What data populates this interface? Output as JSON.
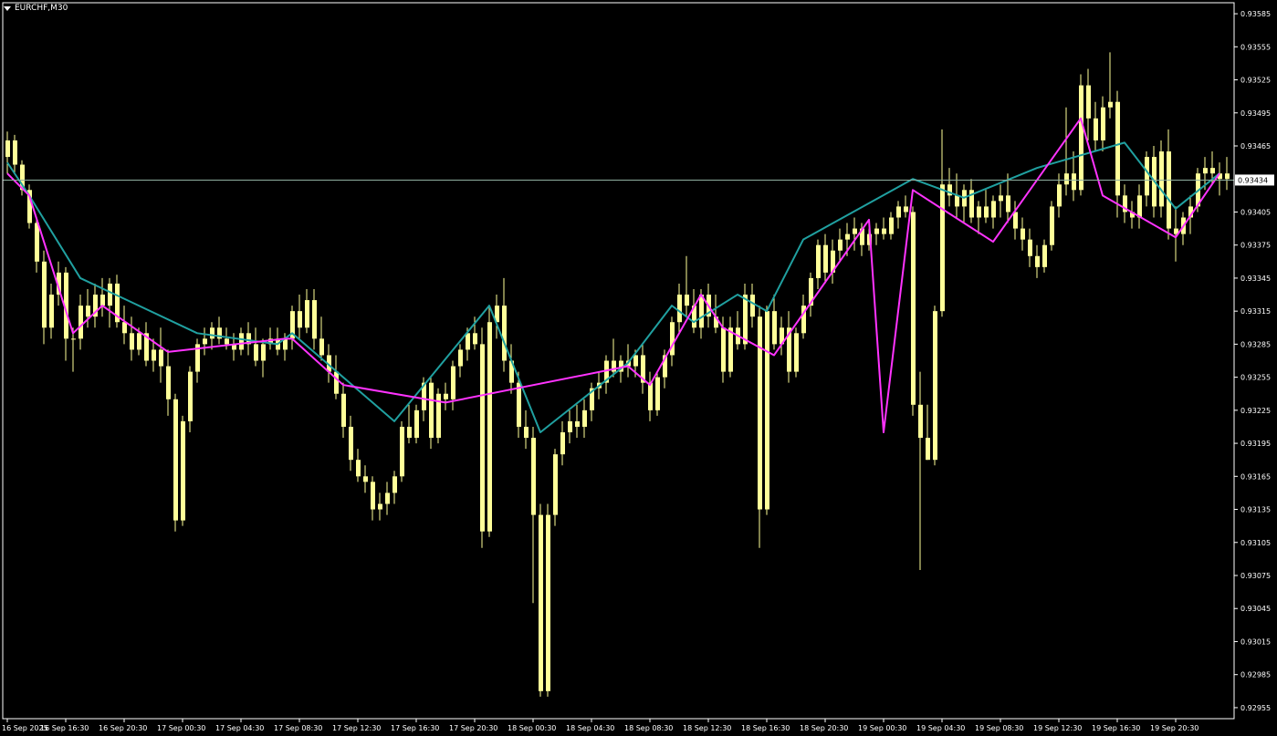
{
  "title": "EURCHF,M30",
  "colors": {
    "background": "#000000",
    "axis": "#ffffff",
    "candle": "#ffff99",
    "zigzag_main": "#ff33ff",
    "zigzag_secondary": "#20a0a0",
    "current_price_line": "#8fb0a0"
  },
  "chart_data": {
    "type": "candlestick",
    "symbol": "EURCHF",
    "timeframe": "M30",
    "y_ticks": [
      "0.93585",
      "0.93555",
      "0.93525",
      "0.93495",
      "0.93465",
      "0.93434",
      "0.93405",
      "0.93375",
      "0.93345",
      "0.93315",
      "0.93285",
      "0.93255",
      "0.93225",
      "0.93195",
      "0.93165",
      "0.93135",
      "0.93105",
      "0.93075",
      "0.93045",
      "0.93015",
      "0.92985",
      "0.92955"
    ],
    "y_range": [
      0.92945,
      0.93595
    ],
    "current_price": 0.93434,
    "x_labels": [
      "16 Sep 2025",
      "16 Sep 16:30",
      "16 Sep 20:30",
      "17 Sep 00:30",
      "17 Sep 04:30",
      "17 Sep 08:30",
      "17 Sep 12:30",
      "17 Sep 16:30",
      "17 Sep 20:30",
      "18 Sep 00:30",
      "18 Sep 04:30",
      "18 Sep 08:30",
      "18 Sep 12:30",
      "18 Sep 16:30",
      "18 Sep 20:30",
      "19 Sep 00:30",
      "19 Sep 04:30",
      "19 Sep 08:30",
      "19 Sep 12:30",
      "19 Sep 16:30",
      "19 Sep 20:30"
    ],
    "bars_per_label": 8,
    "candles": [
      [
        0.93455,
        0.93478,
        0.9344,
        0.9347
      ],
      [
        0.9347,
        0.93475,
        0.9344,
        0.93448
      ],
      [
        0.93448,
        0.93452,
        0.9342,
        0.93425
      ],
      [
        0.93425,
        0.9343,
        0.9339,
        0.93395
      ],
      [
        0.93395,
        0.934,
        0.9335,
        0.9336
      ],
      [
        0.9336,
        0.9337,
        0.93285,
        0.933
      ],
      [
        0.933,
        0.9334,
        0.9329,
        0.9333
      ],
      [
        0.9333,
        0.9336,
        0.9332,
        0.9335
      ],
      [
        0.9335,
        0.93355,
        0.9327,
        0.9329
      ],
      [
        0.9329,
        0.933,
        0.9326,
        0.9329
      ],
      [
        0.9329,
        0.9333,
        0.9328,
        0.9332
      ],
      [
        0.9332,
        0.93335,
        0.933,
        0.9331
      ],
      [
        0.9331,
        0.9334,
        0.933,
        0.9333
      ],
      [
        0.9333,
        0.93345,
        0.9331,
        0.9332
      ],
      [
        0.9332,
        0.93345,
        0.933,
        0.9334
      ],
      [
        0.9334,
        0.93348,
        0.933,
        0.93305
      ],
      [
        0.93305,
        0.9332,
        0.93285,
        0.93295
      ],
      [
        0.93295,
        0.9331,
        0.9327,
        0.9328
      ],
      [
        0.9328,
        0.933,
        0.93275,
        0.93295
      ],
      [
        0.93295,
        0.93305,
        0.93265,
        0.9327
      ],
      [
        0.9327,
        0.9329,
        0.9326,
        0.9328
      ],
      [
        0.9328,
        0.933,
        0.9325,
        0.93265
      ],
      [
        0.93265,
        0.9328,
        0.9322,
        0.93235
      ],
      [
        0.93235,
        0.9324,
        0.93115,
        0.93125
      ],
      [
        0.93125,
        0.9322,
        0.9312,
        0.93215
      ],
      [
        0.93215,
        0.93265,
        0.93205,
        0.9326
      ],
      [
        0.9326,
        0.9329,
        0.9325,
        0.93285
      ],
      [
        0.93285,
        0.933,
        0.93275,
        0.9329
      ],
      [
        0.9329,
        0.93305,
        0.9328,
        0.933
      ],
      [
        0.933,
        0.9331,
        0.93285,
        0.9329
      ],
      [
        0.9329,
        0.933,
        0.9328,
        0.93285
      ],
      [
        0.93285,
        0.93295,
        0.9327,
        0.9328
      ],
      [
        0.9328,
        0.933,
        0.93275,
        0.93295
      ],
      [
        0.93295,
        0.93305,
        0.93275,
        0.93285
      ],
      [
        0.93285,
        0.933,
        0.93265,
        0.9327
      ],
      [
        0.9327,
        0.9329,
        0.93255,
        0.93285
      ],
      [
        0.93285,
        0.933,
        0.9328,
        0.9329
      ],
      [
        0.9329,
        0.933,
        0.93275,
        0.9328
      ],
      [
        0.9328,
        0.93295,
        0.9327,
        0.9329
      ],
      [
        0.9329,
        0.9332,
        0.9328,
        0.93315
      ],
      [
        0.93315,
        0.9333,
        0.9329,
        0.933
      ],
      [
        0.933,
        0.93335,
        0.93295,
        0.93325
      ],
      [
        0.93325,
        0.93335,
        0.9328,
        0.9329
      ],
      [
        0.9329,
        0.9331,
        0.9327,
        0.93275
      ],
      [
        0.93275,
        0.93285,
        0.9325,
        0.9326
      ],
      [
        0.9326,
        0.93275,
        0.93235,
        0.9324
      ],
      [
        0.9324,
        0.9325,
        0.932,
        0.9321
      ],
      [
        0.9321,
        0.9322,
        0.9317,
        0.9318
      ],
      [
        0.9318,
        0.9319,
        0.9316,
        0.93165
      ],
      [
        0.93165,
        0.93175,
        0.9315,
        0.9316
      ],
      [
        0.9316,
        0.93165,
        0.93125,
        0.93135
      ],
      [
        0.93135,
        0.9315,
        0.93125,
        0.9314
      ],
      [
        0.9314,
        0.9316,
        0.9313,
        0.9315
      ],
      [
        0.9315,
        0.9317,
        0.9314,
        0.93165
      ],
      [
        0.93165,
        0.93215,
        0.9316,
        0.9321
      ],
      [
        0.9321,
        0.9323,
        0.93195,
        0.932
      ],
      [
        0.932,
        0.9323,
        0.93195,
        0.93225
      ],
      [
        0.93225,
        0.93255,
        0.93215,
        0.9325
      ],
      [
        0.9325,
        0.93255,
        0.9319,
        0.932
      ],
      [
        0.932,
        0.93245,
        0.93195,
        0.9324
      ],
      [
        0.9324,
        0.9325,
        0.93225,
        0.93235
      ],
      [
        0.93235,
        0.9327,
        0.93225,
        0.93265
      ],
      [
        0.93265,
        0.93285,
        0.93255,
        0.9328
      ],
      [
        0.9328,
        0.933,
        0.9327,
        0.93295
      ],
      [
        0.93295,
        0.9331,
        0.9328,
        0.93285
      ],
      [
        0.93285,
        0.933,
        0.931,
        0.93115
      ],
      [
        0.93115,
        0.9332,
        0.9311,
        0.93305
      ],
      [
        0.93305,
        0.9333,
        0.9329,
        0.9332
      ],
      [
        0.9332,
        0.93345,
        0.9326,
        0.9327
      ],
      [
        0.9327,
        0.93285,
        0.9324,
        0.9325
      ],
      [
        0.9325,
        0.9326,
        0.932,
        0.9321
      ],
      [
        0.9321,
        0.93225,
        0.9319,
        0.932
      ],
      [
        0.932,
        0.9321,
        0.9305,
        0.9313
      ],
      [
        0.9313,
        0.9314,
        0.92965,
        0.9297
      ],
      [
        0.9297,
        0.9314,
        0.92965,
        0.9313
      ],
      [
        0.9313,
        0.9319,
        0.9312,
        0.93185
      ],
      [
        0.93185,
        0.93215,
        0.93175,
        0.93205
      ],
      [
        0.93205,
        0.93225,
        0.93195,
        0.93215
      ],
      [
        0.93215,
        0.9323,
        0.932,
        0.9321
      ],
      [
        0.9321,
        0.93235,
        0.932,
        0.93225
      ],
      [
        0.93225,
        0.9325,
        0.93215,
        0.93245
      ],
      [
        0.93245,
        0.9326,
        0.93235,
        0.9325
      ],
      [
        0.9325,
        0.93275,
        0.9324,
        0.9327
      ],
      [
        0.9327,
        0.9329,
        0.93255,
        0.9326
      ],
      [
        0.9326,
        0.93275,
        0.9325,
        0.9327
      ],
      [
        0.9327,
        0.93285,
        0.93255,
        0.93265
      ],
      [
        0.93265,
        0.9328,
        0.93255,
        0.93275
      ],
      [
        0.93275,
        0.93285,
        0.9324,
        0.9325
      ],
      [
        0.9325,
        0.9326,
        0.93215,
        0.93225
      ],
      [
        0.93225,
        0.9326,
        0.9322,
        0.93255
      ],
      [
        0.93255,
        0.9328,
        0.93245,
        0.93275
      ],
      [
        0.93275,
        0.9331,
        0.93265,
        0.93305
      ],
      [
        0.93305,
        0.9334,
        0.93295,
        0.9333
      ],
      [
        0.9333,
        0.93365,
        0.9331,
        0.9332
      ],
      [
        0.9332,
        0.93335,
        0.93295,
        0.933
      ],
      [
        0.933,
        0.93335,
        0.9329,
        0.9333
      ],
      [
        0.9333,
        0.9334,
        0.933,
        0.9331
      ],
      [
        0.9331,
        0.9333,
        0.93295,
        0.933
      ],
      [
        0.933,
        0.9331,
        0.9325,
        0.9326
      ],
      [
        0.9326,
        0.9331,
        0.93255,
        0.933
      ],
      [
        0.933,
        0.93315,
        0.9328,
        0.93285
      ],
      [
        0.93285,
        0.9334,
        0.9328,
        0.9333
      ],
      [
        0.9333,
        0.9334,
        0.933,
        0.9331
      ],
      [
        0.9331,
        0.9332,
        0.931,
        0.93135
      ],
      [
        0.93135,
        0.9332,
        0.9313,
        0.93315
      ],
      [
        0.93315,
        0.9333,
        0.9328,
        0.93285
      ],
      [
        0.93285,
        0.9331,
        0.93275,
        0.933
      ],
      [
        0.933,
        0.93315,
        0.9325,
        0.9326
      ],
      [
        0.9326,
        0.933,
        0.93255,
        0.93295
      ],
      [
        0.93295,
        0.9333,
        0.9329,
        0.9332
      ],
      [
        0.9332,
        0.9335,
        0.9331,
        0.93345
      ],
      [
        0.93345,
        0.9338,
        0.93335,
        0.93375
      ],
      [
        0.93375,
        0.93385,
        0.9334,
        0.9335
      ],
      [
        0.9335,
        0.9338,
        0.9334,
        0.9337
      ],
      [
        0.9337,
        0.9339,
        0.9336,
        0.9338
      ],
      [
        0.9338,
        0.93395,
        0.93365,
        0.93385
      ],
      [
        0.93385,
        0.934,
        0.9337,
        0.9339
      ],
      [
        0.9339,
        0.93395,
        0.93365,
        0.93375
      ],
      [
        0.93375,
        0.9339,
        0.9337,
        0.93385
      ],
      [
        0.93385,
        0.93395,
        0.93375,
        0.9339
      ],
      [
        0.9339,
        0.934,
        0.9338,
        0.93385
      ],
      [
        0.93385,
        0.93405,
        0.9338,
        0.934
      ],
      [
        0.934,
        0.93415,
        0.9339,
        0.9341
      ],
      [
        0.9341,
        0.9342,
        0.934,
        0.93405
      ],
      [
        0.93405,
        0.9341,
        0.9322,
        0.9323
      ],
      [
        0.9323,
        0.9326,
        0.9308,
        0.932
      ],
      [
        0.932,
        0.9323,
        0.9318,
        0.9318
      ],
      [
        0.9318,
        0.9332,
        0.93175,
        0.93315
      ],
      [
        0.93315,
        0.9348,
        0.9331,
        0.9343
      ],
      [
        0.9343,
        0.93445,
        0.9341,
        0.9342
      ],
      [
        0.9342,
        0.9344,
        0.934,
        0.9341
      ],
      [
        0.9341,
        0.9343,
        0.93395,
        0.93425
      ],
      [
        0.93425,
        0.93435,
        0.93395,
        0.934
      ],
      [
        0.934,
        0.93415,
        0.93385,
        0.9341
      ],
      [
        0.9341,
        0.93425,
        0.93395,
        0.934
      ],
      [
        0.934,
        0.9342,
        0.9339,
        0.93415
      ],
      [
        0.93415,
        0.9343,
        0.934,
        0.9342
      ],
      [
        0.9342,
        0.9344,
        0.93395,
        0.93405
      ],
      [
        0.93405,
        0.93415,
        0.9338,
        0.9339
      ],
      [
        0.9339,
        0.934,
        0.9337,
        0.9338
      ],
      [
        0.9338,
        0.9339,
        0.93355,
        0.93365
      ],
      [
        0.93365,
        0.93375,
        0.93345,
        0.93355
      ],
      [
        0.93355,
        0.9338,
        0.9335,
        0.93375
      ],
      [
        0.93375,
        0.93415,
        0.9337,
        0.9341
      ],
      [
        0.9341,
        0.9344,
        0.934,
        0.9343
      ],
      [
        0.9343,
        0.935,
        0.9342,
        0.9344
      ],
      [
        0.9344,
        0.9346,
        0.93415,
        0.93425
      ],
      [
        0.93425,
        0.9353,
        0.9342,
        0.9352
      ],
      [
        0.9352,
        0.93535,
        0.9347,
        0.9349
      ],
      [
        0.9349,
        0.93505,
        0.9346,
        0.9347
      ],
      [
        0.9347,
        0.9351,
        0.9346,
        0.935
      ],
      [
        0.935,
        0.9355,
        0.9349,
        0.93505
      ],
      [
        0.93505,
        0.93515,
        0.934,
        0.9342
      ],
      [
        0.9342,
        0.9343,
        0.93395,
        0.93405
      ],
      [
        0.93405,
        0.93415,
        0.9339,
        0.934
      ],
      [
        0.934,
        0.9343,
        0.9339,
        0.9342
      ],
      [
        0.9342,
        0.9346,
        0.9341,
        0.93455
      ],
      [
        0.93455,
        0.93465,
        0.934,
        0.9341
      ],
      [
        0.9341,
        0.9347,
        0.934,
        0.9346
      ],
      [
        0.9346,
        0.9348,
        0.9338,
        0.9339
      ],
      [
        0.9339,
        0.9341,
        0.9336,
        0.93385
      ],
      [
        0.93385,
        0.93405,
        0.93375,
        0.934
      ],
      [
        0.934,
        0.9342,
        0.93385,
        0.9341
      ],
      [
        0.9341,
        0.93445,
        0.93405,
        0.9344
      ],
      [
        0.9344,
        0.93455,
        0.93425,
        0.93445
      ],
      [
        0.93445,
        0.9346,
        0.9343,
        0.9344
      ],
      [
        0.9344,
        0.9345,
        0.9342,
        0.93435
      ],
      [
        0.93435,
        0.93455,
        0.93425,
        0.9344
      ],
      [
        0.9344,
        0.9345,
        0.9342,
        0.93435
      ]
    ],
    "zigzag_main": [
      [
        0,
        0.9344
      ],
      [
        3,
        0.9342
      ],
      [
        9,
        0.93295
      ],
      [
        13,
        0.9332
      ],
      [
        22,
        0.93278
      ],
      [
        38,
        0.9329
      ],
      [
        39,
        0.9329
      ],
      [
        46,
        0.93248
      ],
      [
        60,
        0.93232
      ],
      [
        85,
        0.93265
      ],
      [
        88,
        0.93248
      ],
      [
        95,
        0.9333
      ],
      [
        98,
        0.933
      ],
      [
        105,
        0.93275
      ],
      [
        118,
        0.93398
      ],
      [
        120,
        0.93205
      ],
      [
        124,
        0.93425
      ],
      [
        135,
        0.93378
      ],
      [
        147,
        0.9349
      ],
      [
        150,
        0.9342
      ],
      [
        160,
        0.93382
      ],
      [
        166,
        0.9344
      ]
    ],
    "zigzag_secondary": [
      [
        0,
        0.9345
      ],
      [
        3,
        0.9342
      ],
      [
        10,
        0.93345
      ],
      [
        26,
        0.93295
      ],
      [
        37,
        0.93285
      ],
      [
        39,
        0.93295
      ],
      [
        53,
        0.93215
      ],
      [
        66,
        0.9332
      ],
      [
        73,
        0.93205
      ],
      [
        85,
        0.93268
      ],
      [
        91,
        0.9332
      ],
      [
        94,
        0.93305
      ],
      [
        100,
        0.9333
      ],
      [
        104,
        0.93315
      ],
      [
        109,
        0.9338
      ],
      [
        124,
        0.93435
      ],
      [
        131,
        0.93418
      ],
      [
        141,
        0.93445
      ],
      [
        153,
        0.93468
      ],
      [
        160,
        0.93408
      ],
      [
        166,
        0.9344
      ]
    ]
  }
}
